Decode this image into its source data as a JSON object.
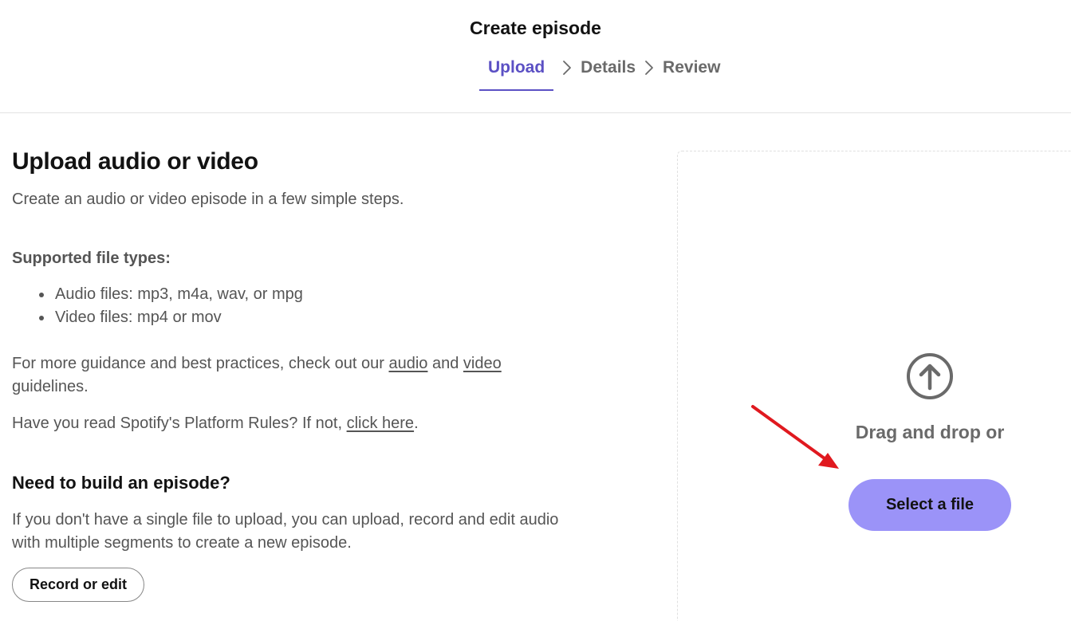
{
  "header": {
    "title": "Create episode",
    "steps": [
      {
        "label": "Upload",
        "active": true
      },
      {
        "label": "Details",
        "active": false
      },
      {
        "label": "Review",
        "active": false
      }
    ],
    "separator_icon": "chevron-right-icon"
  },
  "left": {
    "heading": "Upload audio or video",
    "intro": "Create an audio or video episode in a few simple steps.",
    "supported_title": "Supported file types:",
    "file_types": [
      "Audio files: mp3, m4a, wav, or mpg",
      "Video files: mp4 or mov"
    ],
    "guidance": {
      "prefix": "For more guidance and best practices, check out our ",
      "audio_link": "audio",
      "and": " and ",
      "video_link": "video",
      "suffix": " guidelines."
    },
    "rules": {
      "prefix": "Have you read Spotify's Platform Rules? If not, ",
      "link": "click here",
      "suffix": "."
    },
    "build_heading": "Need to build an episode?",
    "build_text": "If you don't have a single file to upload, you can upload, record and edit audio with multiple segments to create a new episode.",
    "record_button": "Record or edit"
  },
  "dropzone": {
    "icon": "upload-arrow-icon",
    "drag_text": "Drag and drop or",
    "select_button": "Select a file",
    "annotation_icon": "red-arrow-annotation-icon"
  },
  "colors": {
    "accent": "#5b50c4",
    "select_button_bg": "#9b93f8",
    "annotation_arrow": "#e0191f",
    "muted_text": "#555555"
  }
}
